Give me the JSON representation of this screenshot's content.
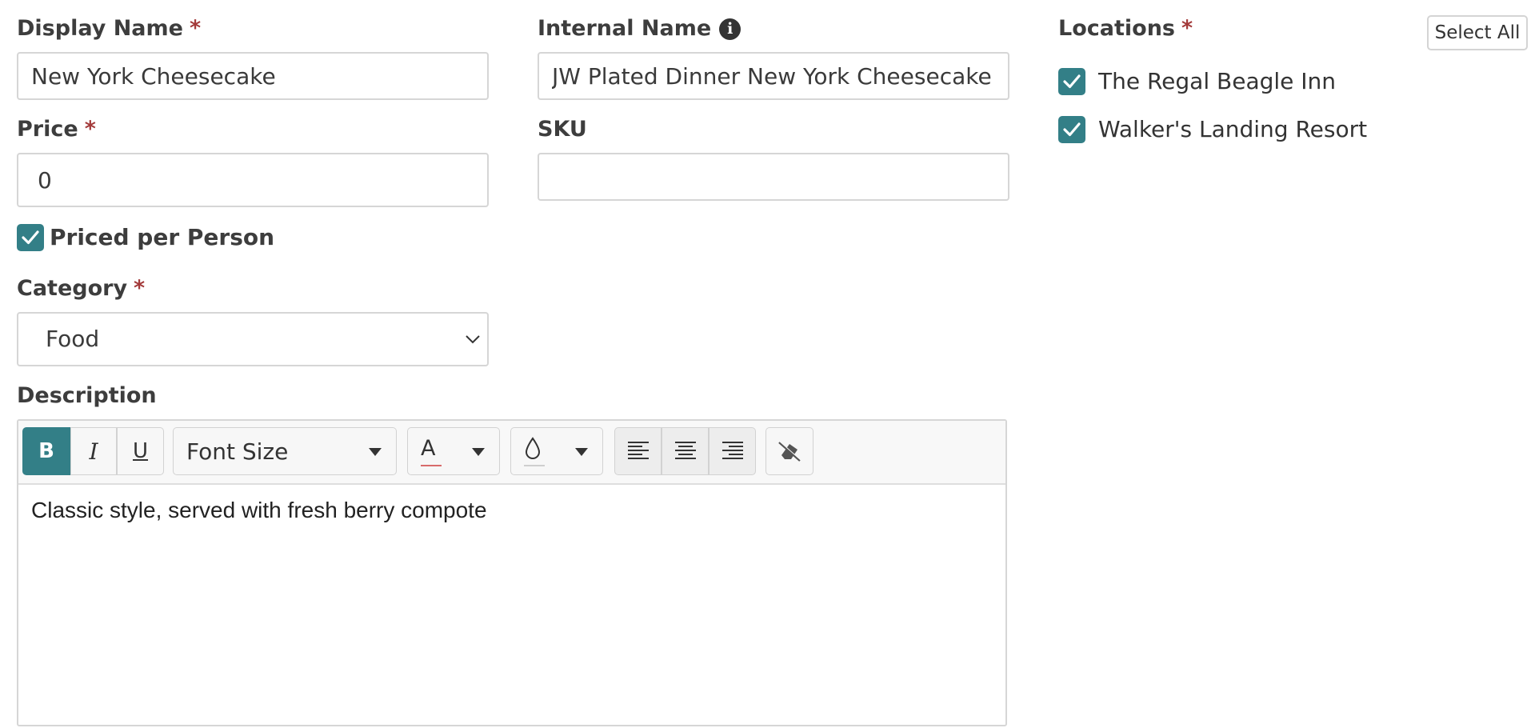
{
  "display_name": {
    "label": "Display Name",
    "required": "*",
    "value": "New York Cheesecake"
  },
  "internal_name": {
    "label": "Internal Name",
    "info_icon": "info-icon",
    "value": "JW Plated Dinner New York Cheesecake"
  },
  "price": {
    "label": "Price",
    "required": "*",
    "value": "0"
  },
  "sku": {
    "label": "SKU",
    "value": ""
  },
  "priced_per_person": {
    "label": "Priced per Person",
    "checked": true
  },
  "category": {
    "label": "Category",
    "required": "*",
    "selected": "Food"
  },
  "description": {
    "label": "Description",
    "font_size_label": "Font Size",
    "font_color_glyph": "A",
    "body": "Classic style, served with fresh berry compote"
  },
  "locations": {
    "label": "Locations",
    "required": "*",
    "select_all_label": "Select All",
    "items": [
      {
        "label": "The Regal Beagle Inn",
        "checked": true
      },
      {
        "label": "Walker's Landing Resort",
        "checked": true
      }
    ]
  },
  "colors": {
    "accent": "#337f87",
    "required": "#a33a3a"
  }
}
